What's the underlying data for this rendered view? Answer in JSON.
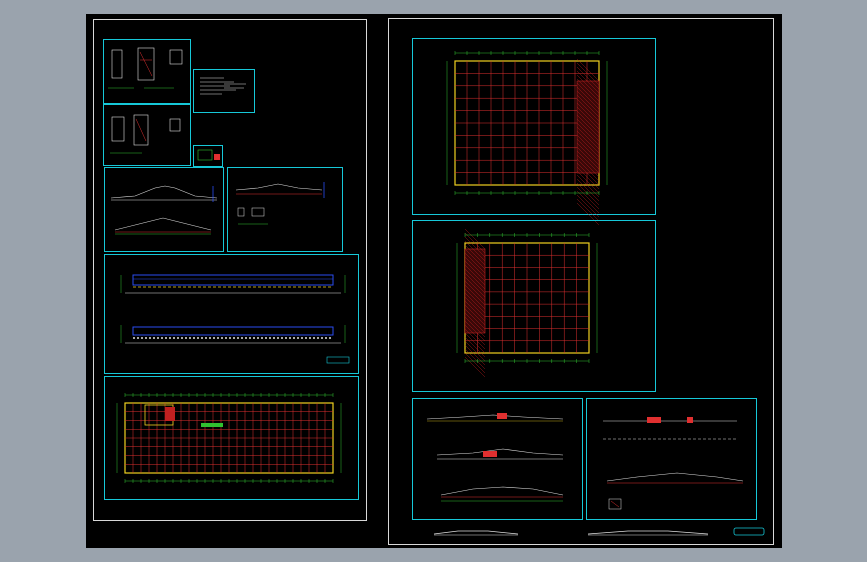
{
  "colors": {
    "background": "#9aa3ad",
    "viewport": "#000000",
    "sheet_border": "#d8d8d8",
    "frame": "#16c8d8",
    "plan_grid": "#e03030",
    "plan_columns": "#f0d020",
    "dimension": "#30c030",
    "elevation_blue": "#2a4df0",
    "hatch": "#c02020",
    "text": "#e0e0e0"
  },
  "left_sheet": {
    "panels": [
      {
        "id": "detail-a",
        "label": "detail-sheet"
      },
      {
        "id": "detail-b",
        "label": "detail-sheet"
      },
      {
        "id": "notes",
        "label": "notes-sheet"
      },
      {
        "id": "section-a",
        "label": "section-sheet"
      },
      {
        "id": "section-b",
        "label": "section-sheet"
      },
      {
        "id": "elevations",
        "label": "elevation-sheet"
      },
      {
        "id": "floor-plan",
        "label": "floor-plan-sheet"
      }
    ]
  },
  "right_sheet": {
    "panels": [
      {
        "id": "roof-plan-1",
        "label": "roof-plan-sheet"
      },
      {
        "id": "roof-plan-2",
        "label": "roof-plan-sheet"
      },
      {
        "id": "sections-left",
        "label": "section-sheet"
      },
      {
        "id": "sections-right",
        "label": "section-sheet"
      }
    ]
  }
}
